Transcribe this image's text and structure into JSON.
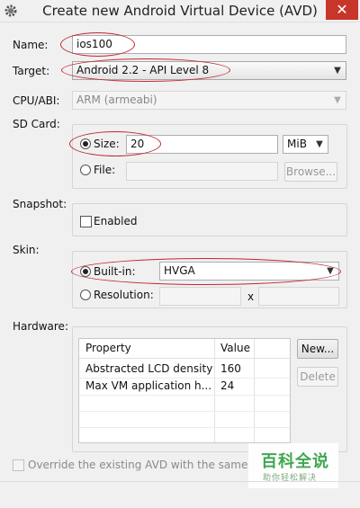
{
  "window": {
    "title": "Create new Android Virtual Device (AVD)",
    "close_glyph": "✕",
    "app_icon": "gear-icon"
  },
  "name": {
    "label": "Name:",
    "value": "ios100"
  },
  "target": {
    "label": "Target:",
    "value": "Android 2.2 - API Level 8"
  },
  "cpu_abi": {
    "label": "CPU/ABI:",
    "value": "ARM (armeabi)"
  },
  "sd_card": {
    "label": "SD Card:",
    "size_label": "Size:",
    "size_value": "20",
    "size_unit": "MiB",
    "file_label": "File:",
    "file_value": "",
    "browse_label": "Browse...",
    "selected": "size"
  },
  "snapshot": {
    "label": "Snapshot:",
    "enabled_label": "Enabled",
    "enabled": false
  },
  "skin": {
    "label": "Skin:",
    "builtin_label": "Built-in:",
    "builtin_value": "HVGA",
    "resolution_label": "Resolution:",
    "resolution_x": "x",
    "selected": "builtin"
  },
  "hardware": {
    "label": "Hardware:",
    "columns": [
      "Property",
      "Value"
    ],
    "rows": [
      {
        "property": "Abstracted LCD density",
        "value": "160"
      },
      {
        "property": "Max VM application h...",
        "value": "24"
      }
    ],
    "new_label": "New...",
    "delete_label": "Delete"
  },
  "override": {
    "label": "Override the existing AVD with the same n",
    "checked": false
  },
  "watermark": {
    "main": "百科全说",
    "sub": "助你轻松解决"
  },
  "colors": {
    "annotation": "#c0282d",
    "close": "#c7352b",
    "watermark": "#3aa54b"
  }
}
